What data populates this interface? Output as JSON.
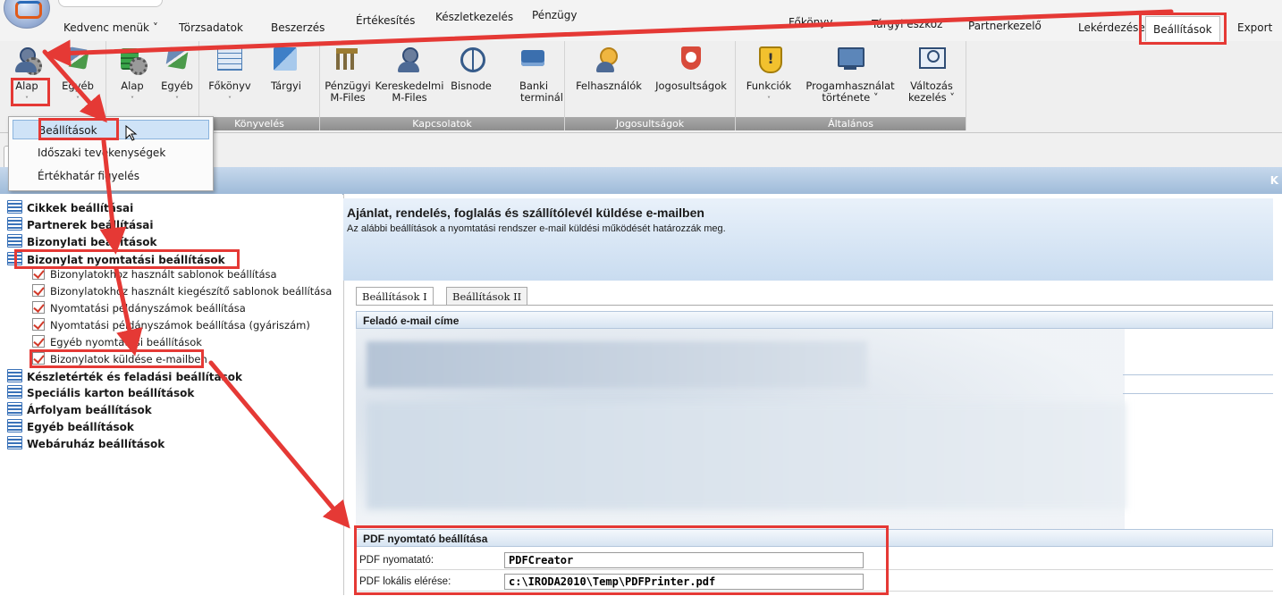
{
  "menu": {
    "items": [
      "Kedvenc menük",
      "Törzsadatok",
      "Beszerzés",
      "Értékesítés",
      "Készletkezelés",
      "Pénzügy",
      "Főkönyv",
      "Tárgyi eszköz",
      "Partnerkezelő",
      "Lekérdezések",
      "Beállítások",
      "Export"
    ],
    "active": "Beállítások"
  },
  "ribbon": {
    "alap1": "Alap",
    "egyeb1": "Egyéb",
    "alap2": "Alap",
    "egyeb2": "Egyéb",
    "fokonyv": "Főkönyv",
    "targyi": "Tárgyi",
    "penzugyi_1": "Pénzügyi",
    "penzugyi_2": "M-Files",
    "keresk_1": "Kereskedelmi",
    "keresk_2": "M-Files",
    "bisnode": "Bisnode",
    "banki_1": "Banki",
    "banki_2": "terminál",
    "felhasznalok": "Felhasználók",
    "jogosultsagok": "Jogosultságok",
    "funkciok": "Funkciók",
    "progam_1": "Progamhasználat",
    "progam_2": "története",
    "valtozas_1": "Változás",
    "valtozas_2": "kezelés",
    "groups": {
      "konyveles": "Könyvelés",
      "kapcsolatok": "Kapcsolatok",
      "jogosultsagok": "Jogosultságok",
      "altalanos": "Általános"
    }
  },
  "dropdown": {
    "items": [
      "Beállítások",
      "Időszaki tevékenységek",
      "Értékhatár figyelés"
    ]
  },
  "bluebar_letter": "K",
  "tree": {
    "nodes": [
      "Cikkek beállításai",
      "Partnerek beállításai",
      "Bizonylati beállítások",
      "Bizonylat nyomtatási beállítások"
    ],
    "leaves": [
      "Bizonylatokhoz használt sablonok beállítása",
      "Bizonylatokhoz használt kiegészítő sablonok beállítása",
      "Nyomtatási példányszámok beállítása",
      "Nyomtatási példányszámok beállítása (gyáriszám)",
      "Egyéb nyomtatási beállítások",
      "Bizonylatok küldése e-mailben"
    ],
    "nodes_after": [
      "Készletérték és feladási beállítások",
      "Speciális karton beállítások",
      "Árfolyam beállítások",
      "Egyéb beállítások",
      "Webáruház beállítások"
    ]
  },
  "panel": {
    "title": "Ajánlat, rendelés, foglalás és szállítólevél küldése e-mailben",
    "subtitle": "Az alábbi beállítások a nyomtatási rendszer e-mail küldési működését határozzák meg.",
    "tabs": [
      "Beállítások I",
      "Beállítások II"
    ],
    "sender_section": "Feladó e-mail címe",
    "pdf_section": "PDF nyomtató beállítása",
    "pdf_printer_label": "PDF nyomatató:",
    "pdf_printer_value": "PDFCreator",
    "pdf_path_label": "PDF lokális elérése:",
    "pdf_path_value": "c:\\IRODA2010\\Temp\\PDFPrinter.pdf"
  },
  "colors": {
    "highlight_red": "#e53935",
    "ribbon_group_label": "#9a9a9a",
    "panel_blue": "#c9dcf0"
  }
}
